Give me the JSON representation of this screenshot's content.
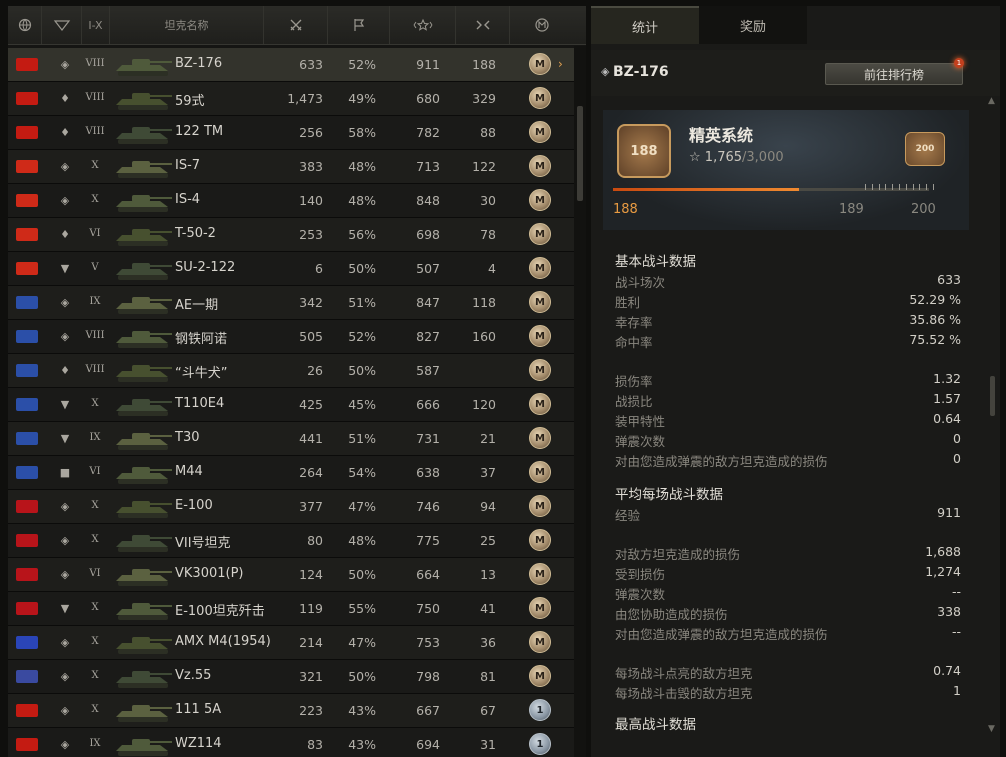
{
  "header": {
    "col_nation_icon": "globe-icon",
    "col_type_icon": "tank-type-icon",
    "col_tier": "I-X",
    "col_name": "坦克名称",
    "col_battles_icon": "crossed-swords-icon",
    "col_win_icon": "flag-icon",
    "col_xp_icon": "star-icon",
    "col_mastery_icon": "mastery-icon",
    "col_marks_icon": "m-badge-icon"
  },
  "tanks": [
    {
      "flag": "#c41b12",
      "type": "◈",
      "tier": "VIII",
      "name": "BZ-176",
      "battles": "633",
      "win": "52%",
      "xp": "911",
      "m": "188",
      "badge": "M",
      "selected": true
    },
    {
      "flag": "#c41b12",
      "type": "♦",
      "tier": "VIII",
      "name": "59式",
      "battles": "1,473",
      "win": "49%",
      "xp": "680",
      "m": "329",
      "badge": "M"
    },
    {
      "flag": "#c41b12",
      "type": "♦",
      "tier": "VIII",
      "name": "122 TM",
      "battles": "256",
      "win": "58%",
      "xp": "782",
      "m": "88",
      "badge": "M"
    },
    {
      "flag": "#cf2a18",
      "type": "◈",
      "tier": "X",
      "name": "IS-7",
      "battles": "383",
      "win": "48%",
      "xp": "713",
      "m": "122",
      "badge": "M"
    },
    {
      "flag": "#cf2a18",
      "type": "◈",
      "tier": "X",
      "name": "IS-4",
      "battles": "140",
      "win": "48%",
      "xp": "848",
      "m": "30",
      "badge": "M"
    },
    {
      "flag": "#cf2a18",
      "type": "♦",
      "tier": "VI",
      "name": "T-50-2",
      "battles": "253",
      "win": "56%",
      "xp": "698",
      "m": "78",
      "badge": "M"
    },
    {
      "flag": "#cf2a18",
      "type": "▼",
      "tier": "V",
      "name": "SU-2-122",
      "battles": "6",
      "win": "50%",
      "xp": "507",
      "m": "4",
      "badge": "M"
    },
    {
      "flag": "#2b4fa8",
      "type": "◈",
      "tier": "IX",
      "name": "AE一期",
      "battles": "342",
      "win": "51%",
      "xp": "847",
      "m": "118",
      "badge": "M"
    },
    {
      "flag": "#2b4fa8",
      "type": "◈",
      "tier": "VIII",
      "name": "钢铁阿诺",
      "battles": "505",
      "win": "52%",
      "xp": "827",
      "m": "160",
      "badge": "M"
    },
    {
      "flag": "#2b4fa8",
      "type": "♦",
      "tier": "VIII",
      "name": "“斗牛犬”",
      "battles": "26",
      "win": "50%",
      "xp": "587",
      "m": "",
      "badge": "M"
    },
    {
      "flag": "#2b4fa8",
      "type": "▼",
      "tier": "X",
      "name": "T110E4",
      "battles": "425",
      "win": "45%",
      "xp": "666",
      "m": "120",
      "badge": "M"
    },
    {
      "flag": "#2b4fa8",
      "type": "▼",
      "tier": "IX",
      "name": "T30",
      "battles": "441",
      "win": "51%",
      "xp": "731",
      "m": "21",
      "badge": "M"
    },
    {
      "flag": "#2b4fa8",
      "type": "■",
      "tier": "VI",
      "name": "M44",
      "battles": "264",
      "win": "54%",
      "xp": "638",
      "m": "37",
      "badge": "M"
    },
    {
      "flag": "#b8141a",
      "type": "◈",
      "tier": "X",
      "name": "E-100",
      "battles": "377",
      "win": "47%",
      "xp": "746",
      "m": "94",
      "badge": "M"
    },
    {
      "flag": "#b8141a",
      "type": "◈",
      "tier": "X",
      "name": "VII号坦克",
      "battles": "80",
      "win": "48%",
      "xp": "775",
      "m": "25",
      "badge": "M"
    },
    {
      "flag": "#b8141a",
      "type": "◈",
      "tier": "VI",
      "name": "VK3001(P)",
      "battles": "124",
      "win": "50%",
      "xp": "664",
      "m": "13",
      "badge": "M"
    },
    {
      "flag": "#b8141a",
      "type": "▼",
      "tier": "X",
      "name": "E-100坦克歼击",
      "battles": "119",
      "win": "55%",
      "xp": "750",
      "m": "41",
      "badge": "M"
    },
    {
      "flag": "#2a45b8",
      "type": "◈",
      "tier": "X",
      "name": "AMX M4(1954)",
      "battles": "214",
      "win": "47%",
      "xp": "753",
      "m": "36",
      "badge": "M"
    },
    {
      "flag": "#3a4aa0",
      "type": "◈",
      "tier": "X",
      "name": "Vz.55",
      "battles": "321",
      "win": "50%",
      "xp": "798",
      "m": "81",
      "badge": "M"
    },
    {
      "flag": "#c41b12",
      "type": "◈",
      "tier": "X",
      "name": "111 5A",
      "battles": "223",
      "win": "43%",
      "xp": "667",
      "m": "67",
      "badge": "1"
    },
    {
      "flag": "#c41b12",
      "type": "◈",
      "tier": "IX",
      "name": "WZ114",
      "battles": "83",
      "win": "43%",
      "xp": "694",
      "m": "31",
      "badge": "1"
    }
  ],
  "tabs": {
    "stats": "统计",
    "rewards": "奖励"
  },
  "detail": {
    "type_icon": "◈",
    "tank_name": "BZ-176",
    "rank_button": "前往排行榜",
    "notif_count": "1"
  },
  "elite": {
    "title": "精英系统",
    "level": "188",
    "next_badge": "200",
    "xp_current": "1,765",
    "xp_total": "/3,000",
    "progress": 0.588,
    "lv_cur": "188",
    "lv_next": "189",
    "lv_max": "200"
  },
  "stats": {
    "basic_title": "基本战斗数据",
    "basic": [
      {
        "label": "战斗场次",
        "value": "633"
      },
      {
        "label": "胜利",
        "value": "52.29 %"
      },
      {
        "label": "幸存率",
        "value": "35.86 %"
      },
      {
        "label": "命中率",
        "value": "75.52 %"
      }
    ],
    "ratios": [
      {
        "label": "损伤率",
        "value": "1.32"
      },
      {
        "label": "战损比",
        "value": "1.57"
      },
      {
        "label": "装甲特性",
        "value": "0.64"
      },
      {
        "label": "弹震次数",
        "value": "0"
      },
      {
        "label": "对由您造成弹震的敌方坦克造成的损伤",
        "value": "0"
      }
    ],
    "avg_title": "平均每场战斗数据",
    "avg_xp": [
      {
        "label": "经验",
        "value": "911"
      }
    ],
    "avg_dmg": [
      {
        "label": "对敌方坦克造成的损伤",
        "value": "1,688"
      },
      {
        "label": "受到损伤",
        "value": "1,274"
      },
      {
        "label": "弹震次数",
        "value": "--"
      },
      {
        "label": "由您协助造成的损伤",
        "value": "338"
      },
      {
        "label": "对由您造成弹震的敌方坦克造成的损伤",
        "value": "--"
      }
    ],
    "avg_kill": [
      {
        "label": "每场战斗点亮的敌方坦克",
        "value": "0.74"
      },
      {
        "label": "每场战斗击毁的敌方坦克",
        "value": "1"
      }
    ],
    "max_title": "最高战斗数据"
  }
}
